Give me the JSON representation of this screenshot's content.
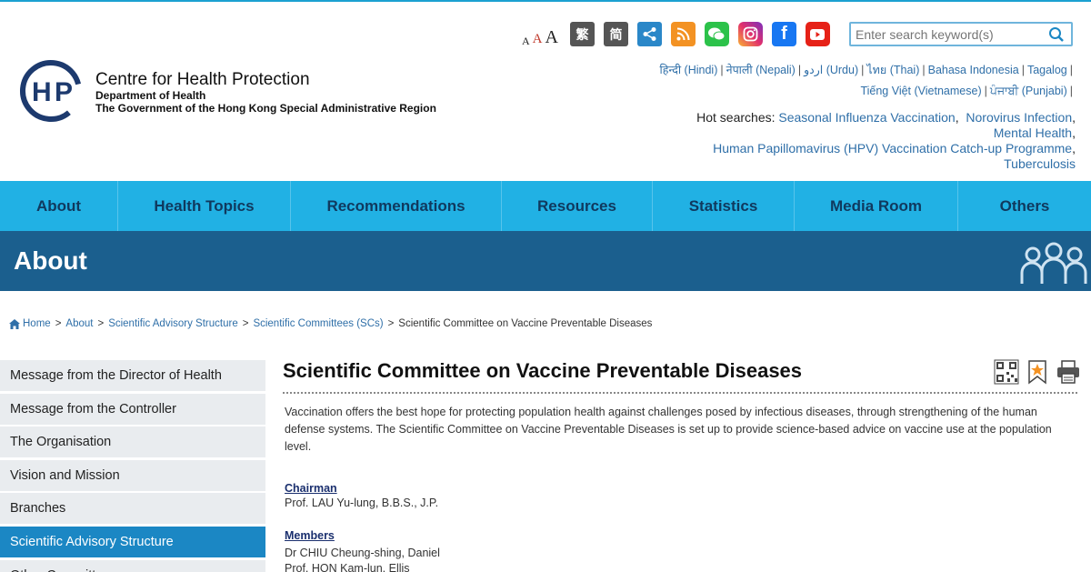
{
  "header": {
    "org_name": "Centre for Health Protection",
    "dept": "Department of Health",
    "gov": "The Government of the Hong Kong Special Administrative Region",
    "font_sizes": [
      "A",
      "A",
      "A"
    ],
    "tools": {
      "trad": "繁",
      "simp": "简"
    },
    "search_placeholder": "Enter search keyword(s)",
    "languages_line1": [
      "हिन्दी (Hindi)",
      "नेपाली (Nepali)",
      "اردو (Urdu)",
      "ไทย (Thai)",
      "Bahasa Indonesia",
      "Tagalog"
    ],
    "languages_line2": [
      "Tiếng Việt (Vietnamese)",
      "ਪੰਜਾਬੀ (Punjabi)"
    ],
    "hot_label": "Hot searches:",
    "hot_searches": [
      "Seasonal Influenza Vaccination",
      "Norovirus Infection",
      "Mental Health",
      "Human Papillomavirus (HPV) Vaccination Catch-up Programme",
      "Tuberculosis"
    ]
  },
  "nav": [
    "About",
    "Health Topics",
    "Recommendations",
    "Resources",
    "Statistics",
    "Media Room",
    "Others"
  ],
  "banner": {
    "title": "About"
  },
  "breadcrumb": [
    "Home",
    "About",
    "Scientific Advisory Structure",
    "Scientific Committees (SCs)",
    "Scientific Committee on Vaccine Preventable Diseases"
  ],
  "sidebar": [
    "Message from the Director of Health",
    "Message from the Controller",
    "The Organisation",
    "Vision and Mission",
    "Branches",
    "Scientific Advisory Structure",
    "Other Committees"
  ],
  "sidebar_active": "Scientific Advisory Structure",
  "main": {
    "title": "Scientific Committee on Vaccine Preventable Diseases",
    "intro": "Vaccination offers the best hope for protecting population health against challenges posed by infectious diseases, through strengthening of the human defense systems. The Scientific Committee on Vaccine Preventable Diseases is set up to provide science-based advice on vaccine use at the population level.",
    "chairman_label": "Chairman",
    "chairman": "Prof. LAU Yu-lung, B.B.S., J.P.",
    "members_label": "Members",
    "members": [
      "Dr CHIU Cheung-shing, Daniel",
      "Prof. HON Kam-lun, Ellis"
    ]
  },
  "colors": {
    "nav_bg": "#21b1e4",
    "banner_bg": "#1b5f8e",
    "active_side": "#1b87c4",
    "link": "#2f6fa8"
  }
}
